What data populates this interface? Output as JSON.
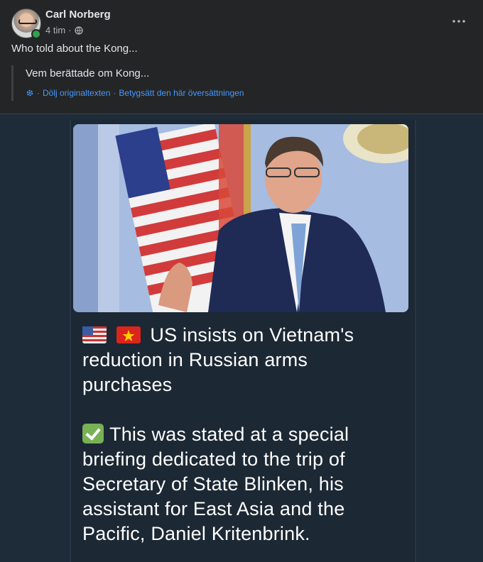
{
  "post": {
    "author": "Carl Norberg",
    "time": "4 tim",
    "meta_sep": "·",
    "text": "Who told about the Kong...",
    "original_text": "Vem berättade om Kong...",
    "hide_original_label": "Dölj originaltexten",
    "link_sep": "·",
    "rate_translation_label": "Betygsätt den här översättningen",
    "more_icon": "more-dots-icon",
    "privacy_icon": "globe-icon",
    "online_color": "#31a24c"
  },
  "image": {
    "headline": "US insists on Vietnam's reduction in Russian arms purchases",
    "body": "This was stated at a special briefing dedicated to the trip of Secretary of State Blinken, his assistant for East Asia and the Pacific, Daniel Kritenbrink.",
    "headline_icons": [
      "us-flag-icon",
      "vietnam-flag-icon"
    ],
    "body_icon": "check-mark-icon"
  }
}
